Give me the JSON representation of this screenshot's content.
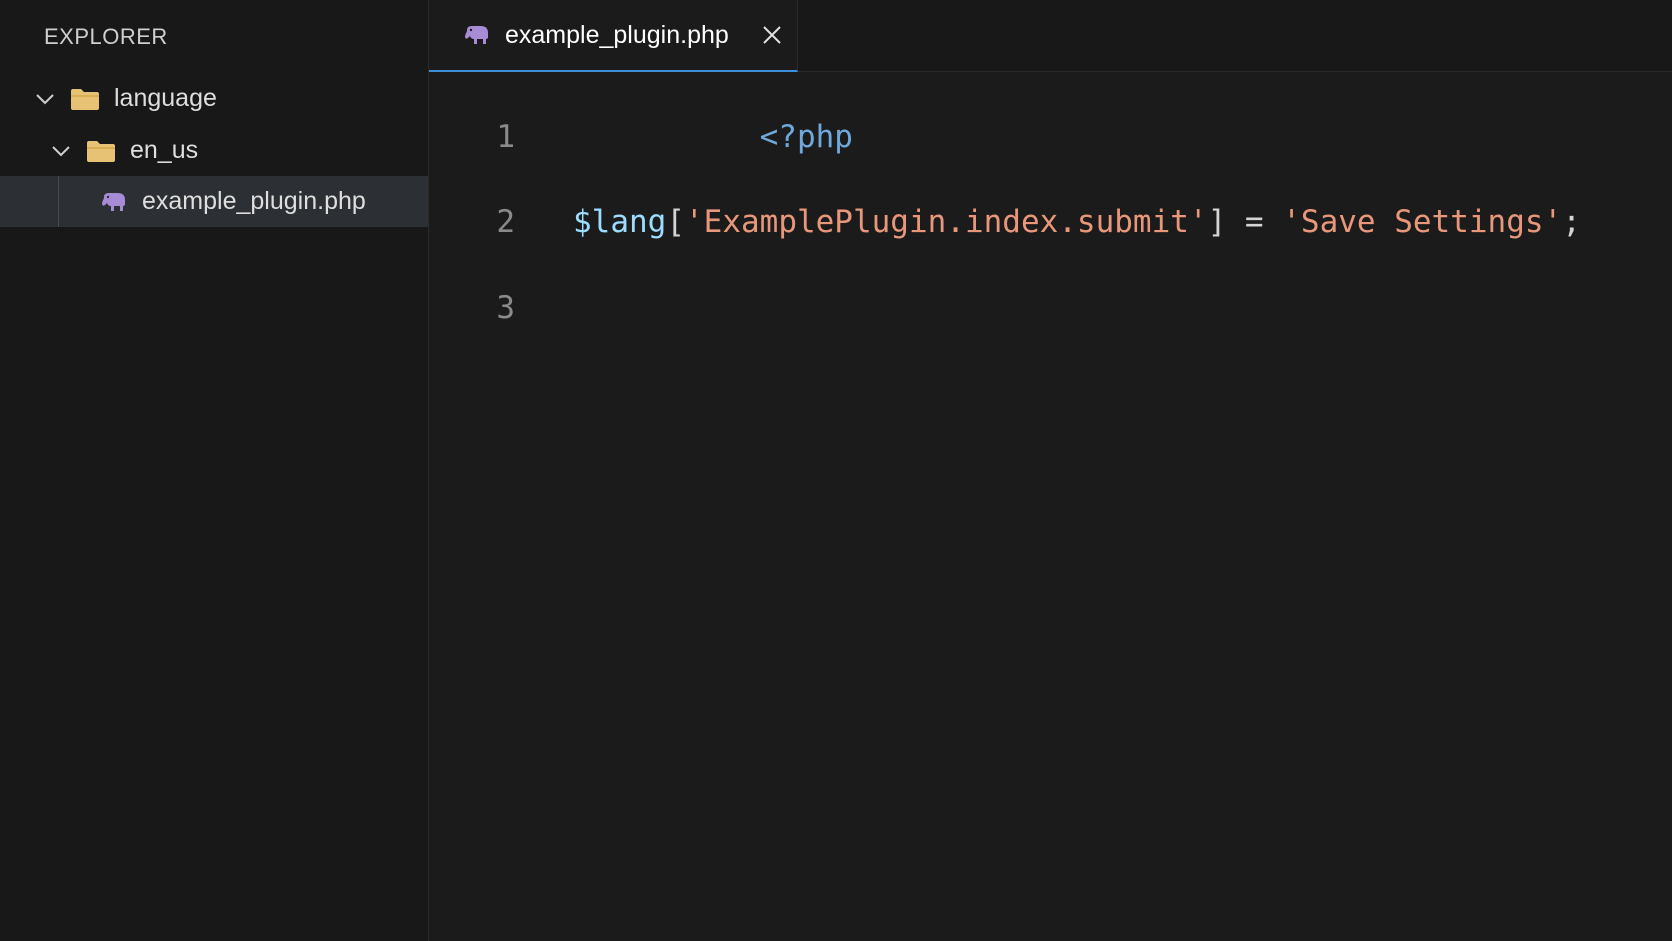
{
  "sidebar": {
    "title": "EXPLORER",
    "tree": [
      {
        "label": "language",
        "type": "folder",
        "expanded": true,
        "icon": "folder-icon"
      },
      {
        "label": "en_us",
        "type": "folder",
        "expanded": true,
        "icon": "folder-icon"
      },
      {
        "label": "example_plugin.php",
        "type": "file",
        "selected": true,
        "icon": "php-elephant-icon"
      }
    ]
  },
  "tabs": [
    {
      "label": "example_plugin.php",
      "active": true,
      "icon": "php-elephant-icon"
    }
  ],
  "editor": {
    "lines": [
      {
        "number": "1",
        "tokens": [
          {
            "text": "<?php",
            "kind": "tag"
          }
        ]
      },
      {
        "number": "2",
        "tokens": [
          {
            "text": "$lang",
            "kind": "var"
          },
          {
            "text": "[",
            "kind": "punc"
          },
          {
            "text": "'ExamplePlugin.index.submit'",
            "kind": "str"
          },
          {
            "text": "] = ",
            "kind": "punc"
          },
          {
            "text": "'Save Settings'",
            "kind": "str"
          },
          {
            "text": ";",
            "kind": "punc"
          }
        ]
      },
      {
        "number": "3",
        "tokens": []
      }
    ]
  },
  "colors": {
    "background": "#1b1b1b",
    "sidebar": "#181818",
    "selection": "#2c2f33",
    "tab_accent": "#3b8fd6",
    "folder": "#e8c274",
    "php_icon": "#a78bd4",
    "string": "#e8977a",
    "variable": "#9cdcfe",
    "tag": "#6fa8dc"
  }
}
